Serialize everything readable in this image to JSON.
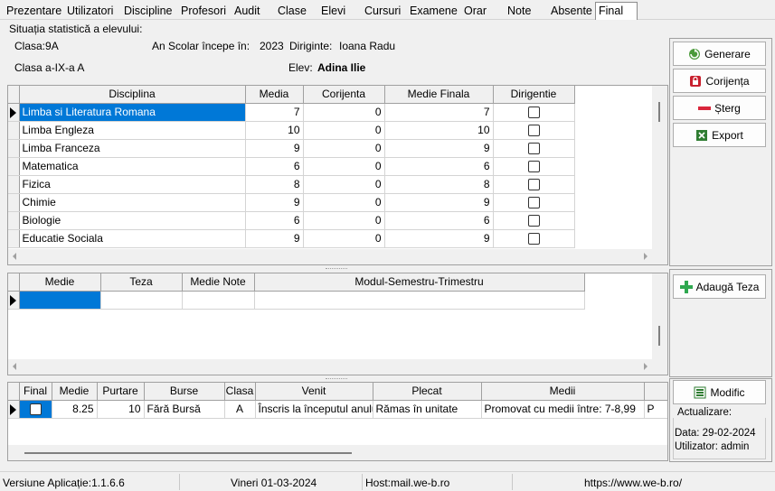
{
  "tabs": [
    "Prezentare",
    "Utilizatori",
    "Discipline",
    "Profesori",
    "Audit",
    "Clase",
    "Elevi",
    "Cursuri",
    "Examene",
    "Orar",
    "Note",
    "Absente",
    "Final"
  ],
  "group_title": "Situația statistică a elevului:",
  "info": {
    "clasa_label": "Clasa:9A",
    "an_label": "An Scolar începe în:",
    "an_value": "2023",
    "diriginte_label": "Diriginte:",
    "diriginte_value": "Ioana Radu",
    "clasa_full": "Clasa a-IX-a A",
    "elev_label": "Elev:",
    "elev_value": "Adina Ilie"
  },
  "grades_grid": {
    "columns": [
      "Disciplina",
      "Media",
      "Corijenta",
      "Medie Finala",
      "Dirigentie"
    ],
    "rows": [
      {
        "disciplina": "Limba si Literatura Romana",
        "media": "7",
        "corijenta": "0",
        "medie_finala": "7"
      },
      {
        "disciplina": "Limba Engleza",
        "media": "10",
        "corijenta": "0",
        "medie_finala": "10"
      },
      {
        "disciplina": "Limba Franceza",
        "media": "9",
        "corijenta": "0",
        "medie_finala": "9"
      },
      {
        "disciplina": "Matematica",
        "media": "6",
        "corijenta": "0",
        "medie_finala": "6"
      },
      {
        "disciplina": "Fizica",
        "media": "8",
        "corijenta": "0",
        "medie_finala": "8"
      },
      {
        "disciplina": "Chimie",
        "media": "9",
        "corijenta": "0",
        "medie_finala": "9"
      },
      {
        "disciplina": "Biologie",
        "media": "6",
        "corijenta": "0",
        "medie_finala": "6"
      },
      {
        "disciplina": "Educatie Sociala",
        "media": "9",
        "corijenta": "0",
        "medie_finala": "9"
      }
    ]
  },
  "teza_grid": {
    "columns": [
      "Medie",
      "Teza",
      "Medie Note",
      "Modul-Semestru-Trimestru"
    ]
  },
  "final_grid": {
    "columns": [
      "Final",
      "Medie",
      "Purtare",
      "Burse",
      "Clasa",
      "Venit",
      "Plecat",
      "Medii",
      ""
    ],
    "row": {
      "medie": "8.25",
      "purtare": "10",
      "burse": "Fără Bursă",
      "clasa": "A",
      "venit": "Înscris la începutul anului",
      "plecat": "Rămas în unitate",
      "medii": "Promovat cu medii între: 7-8,99",
      "extra": "P"
    }
  },
  "buttons": {
    "generare": "Generare",
    "corijenta": "Corijența",
    "sterg": "Șterg",
    "export": "Export",
    "adauga_teza": "Adaugă Teza",
    "modific": "Modific"
  },
  "actualizare": {
    "title": "Actualizare:",
    "data": "Data: 29-02-2024",
    "utilizator": "Utilizator: admin"
  },
  "status": {
    "versiune": "Versiune Aplicație:1.1.6.6",
    "data": "Vineri 01-03-2024",
    "host": "Host:mail.we-b.ro",
    "url": "https://www.we-b.ro/"
  },
  "colors": {
    "selection": "#0078d7",
    "delete_red": "#d9263b",
    "add_green": "#2fa84f",
    "lock_red": "#c8202e"
  }
}
